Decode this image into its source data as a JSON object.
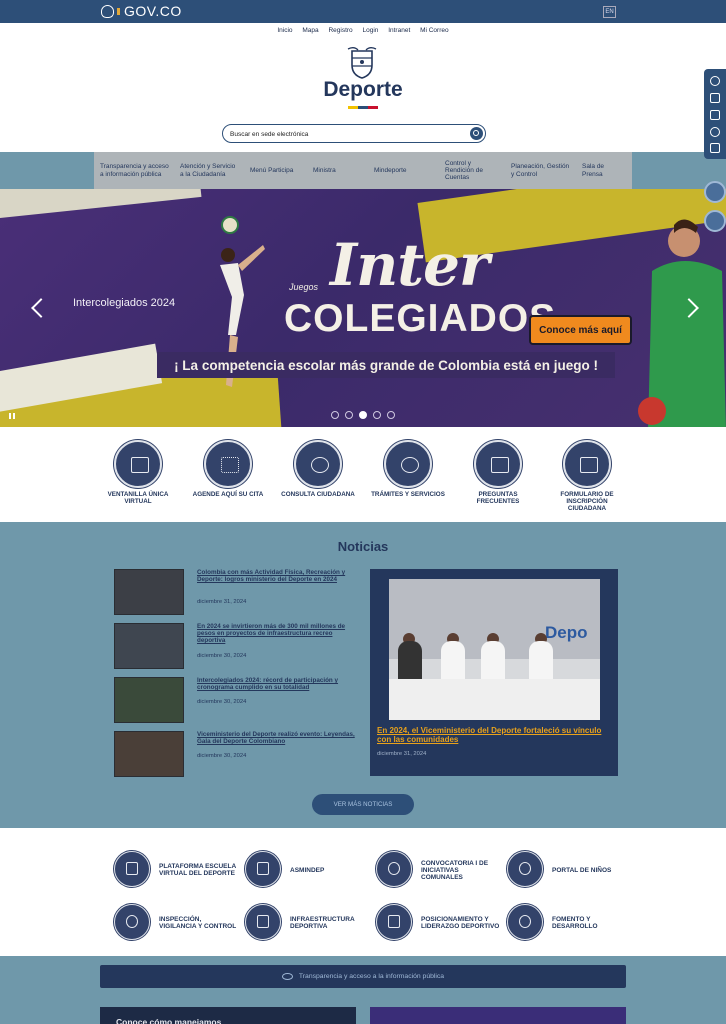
{
  "gov": {
    "logo_text": "GOV.CO",
    "lang_label": "EN"
  },
  "topnav": [
    {
      "label": "Inicio"
    },
    {
      "label": "Mapa"
    },
    {
      "label": "Registro"
    },
    {
      "label": "Login"
    },
    {
      "label": "Intranet"
    },
    {
      "label": "Mi Correo"
    }
  ],
  "brand": {
    "name": "Deporte",
    "flag_colors": [
      "#f2c200",
      "#2d4f78",
      "#c8102e"
    ]
  },
  "search": {
    "placeholder": "Buscar en sede electrónica"
  },
  "mainnav": [
    {
      "label": "Transparencia y acceso a información pública"
    },
    {
      "label": "Atención y Servicio a la Ciudadanía"
    },
    {
      "label": "Menú Participa"
    },
    {
      "label": "Ministra"
    },
    {
      "label": "Mindeporte"
    },
    {
      "label": "Control y Rendición de Cuentas"
    },
    {
      "label": "Planeación, Gestión y Control"
    },
    {
      "label": "Sala de Prensa"
    }
  ],
  "hero": {
    "slide_title": "Intercolegiados 2024",
    "juegos": "Juegos",
    "inter": "Inter",
    "colegiados": "COLEGIADOS",
    "cta": "Conoce más aquí",
    "tagline": "¡ La competencia escolar más grande de Colombia está en juego !",
    "active_dot": 3,
    "dot_count": 5
  },
  "quick": [
    {
      "label": "VENTANILLA ÚNICA VIRTUAL",
      "icon": "window-icon"
    },
    {
      "label": "AGENDE AQUÍ SU CITA",
      "icon": "chat-icon"
    },
    {
      "label": "CONSULTA CIUDADANA",
      "icon": "headset-icon"
    },
    {
      "label": "TRÁMITES Y SERVICIOS",
      "icon": "badge-icon"
    },
    {
      "label": "PREGUNTAS FRECUENTES",
      "icon": "question-icon"
    },
    {
      "label": "FORMULARIO DE INSCRIPCIÓN CIUDADANA",
      "icon": "clipboard-icon"
    }
  ],
  "news": {
    "heading": "Noticias",
    "items": [
      {
        "title": "Colombia con más Actividad Física, Recreación y Deporte: logros ministerio del Deporte en 2024",
        "date": "diciembre 31, 2024"
      },
      {
        "title": "En 2024 se invirtieron más de 300 mil millones de pesos en proyectos de infraestructura recreo deportiva",
        "date": "diciembre 30, 2024"
      },
      {
        "title": "Intercolegiados 2024: récord de participación y cronograma cumplido en su totalidad",
        "date": "diciembre 30, 2024"
      },
      {
        "title": "Viceministerio del Deporte realizó evento: Leyendas, Gala del Deporte Colombiano",
        "date": "diciembre 30, 2024"
      }
    ],
    "featured": {
      "title": "En 2024, el Viceministerio del Deporte fortaleció su vínculo con las comunidades",
      "date": "diciembre 31, 2024",
      "photo_logo": "Depo"
    },
    "more_label": "VER MÁS NOTICIAS"
  },
  "links": [
    {
      "label": "PLATAFORMA ESCUELA VIRTUAL DEL DEPORTE",
      "icon": "monitor-icon"
    },
    {
      "label": "ASMINDEP",
      "icon": "book-icon"
    },
    {
      "label": "CONVOCATORIA I DE INICIATIVAS COMUNALES",
      "icon": "people-icon"
    },
    {
      "label": "PORTAL DE NIÑOS",
      "icon": "child-icon"
    },
    {
      "label": "INSPECCIÓN, VIGILANCIA Y CONTROL",
      "icon": "magnifier-icon"
    },
    {
      "label": "INFRAESTRUCTURA DEPORTIVA",
      "icon": "building-icon"
    },
    {
      "label": "POSICIONAMIENTO Y LIDERAZGO DEPORTIVO",
      "icon": "flag-icon"
    },
    {
      "label": "FOMENTO Y DESARROLLO",
      "icon": "network-icon"
    }
  ],
  "footer": {
    "transparency": "Transparencia y acceso a la información pública",
    "card_a": "Conoce cómo manejamos"
  }
}
